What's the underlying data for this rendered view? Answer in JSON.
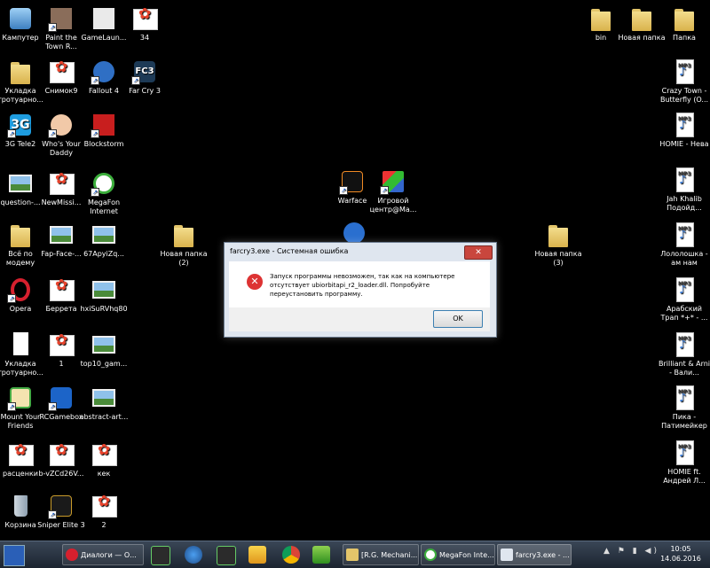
{
  "desktop": {
    "icons": {
      "kompyuter": "Кампутер",
      "paint_town": "Paint the Town R...",
      "gamelauncher": "GameLaun...",
      "i34": "34",
      "bin": "bin",
      "novaya_papka": "Новая папка",
      "papka": "Папка",
      "ukladka1": "Укладка тротуарно...",
      "snimok9": "Снимок9",
      "fallout4": "Fallout 4",
      "farcry3": "Far Cry 3",
      "crazy_town": "Crazy Town - Butterfly (O...",
      "tele2": "3G Tele2",
      "whos_daddy": "Who's Your Daddy",
      "blockstorm": "Blockstorm",
      "homie_neva": "HOMIE - Нева",
      "question": "question-...",
      "newmission": "NewMissi...",
      "megafon_internet": "MegaFon Internet",
      "warface": "Warface",
      "game_center": "Игровой центр@Ма...",
      "jah_khalib": "Jah Khalib Подойд...",
      "vse_po_modemu": "Всё по модему",
      "fap_face": "Fap-Face-...",
      "apyizq": "67ApyiZq...",
      "novaya_papka2": "Новая папка (2)",
      "novaya_papka3": "Новая папка (3)",
      "lolo": "Лололошка - ам нам",
      "opera": "Opera",
      "berretta": "Беррета",
      "hxisurvhq": "hxiSuRVhq80",
      "arab_trap": "Арабский Трап *+* - ...",
      "ukladka2": "Укладка тротуарно...",
      "one": "1",
      "top10": "top10_gam...",
      "brilliant": "Brilliant & Arni - Вали...",
      "mount_friends": "Mount Your Friends",
      "rcgamebox": "RCGamebox",
      "abstract_art": "abstract-art...",
      "pika": "Пика - Патимейкер",
      "rascenki": "расценки",
      "bvzcd": "b-vZCd26V...",
      "kek": "кек",
      "homie_andrey": "HOMIE ft. Андрей Л...",
      "korzina": "Корзина",
      "sniper3": "Sniper Elite 3",
      "two": "2",
      "mp3_tag": "MP3",
      "fc3_tag": "FC3",
      "tele2_tag": "3G"
    }
  },
  "dialog": {
    "title": "farcry3.exe - Системная ошибка",
    "close_glyph": "✕",
    "error_glyph": "✕",
    "message": "Запуск программы невозможен, так как на компьютере отсутствует ubiorbitapi_r2_loader.dll. Попробуйте переустановить программу.",
    "ok_label": "OK"
  },
  "taskbar": {
    "tasks": [
      {
        "label": "Диалоги — О..."
      },
      {
        "label": "[R.G. Mechani..."
      },
      {
        "label": "MegaFon Inte..."
      },
      {
        "label": "farcry3.exe - ..."
      }
    ],
    "tray_glyphs": "▲ ⚑ ▮ ◀)",
    "time": "10:05",
    "date": "14.06.2016"
  },
  "colors": {
    "desktop_bg": "#000000",
    "error_red": "#dd3333",
    "ok_border": "#3c7fb1"
  }
}
